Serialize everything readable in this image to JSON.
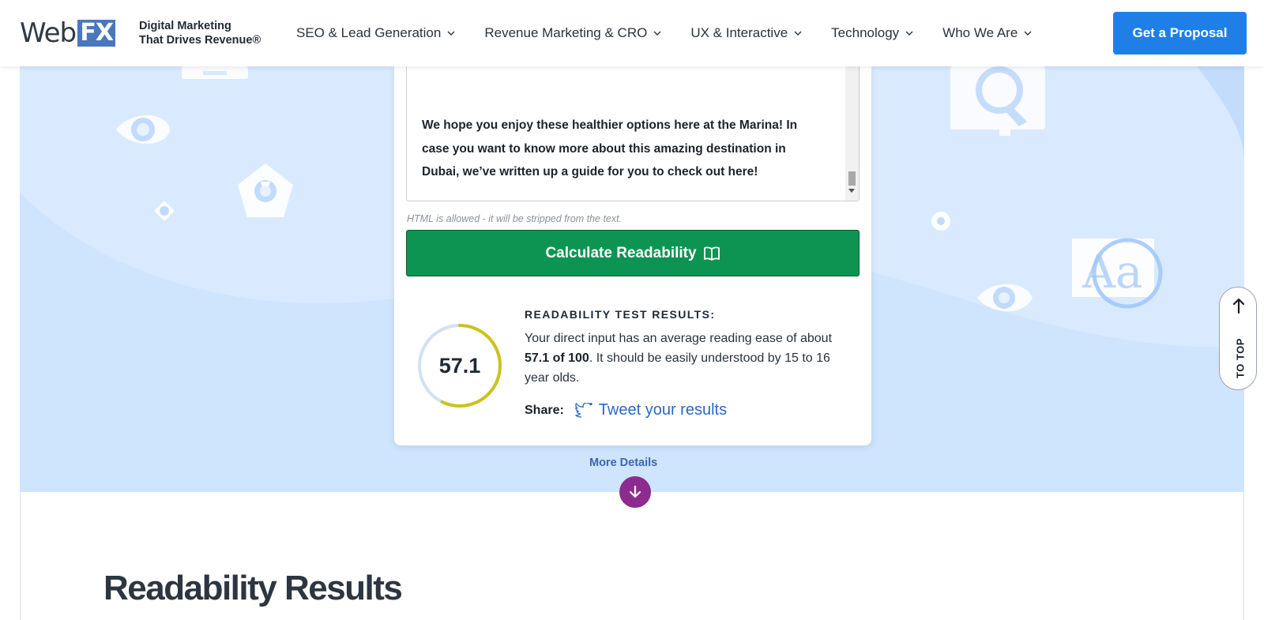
{
  "header": {
    "logo": {
      "web": "Web",
      "fx": "FX"
    },
    "tagline_line1": "Digital Marketing",
    "tagline_line2": "That Drives Revenue®",
    "nav": [
      {
        "label": "SEO & Lead Generation"
      },
      {
        "label": "Revenue Marketing & CRO"
      },
      {
        "label": "UX & Interactive"
      },
      {
        "label": "Technology"
      },
      {
        "label": "Who We Are"
      }
    ],
    "cta_label": "Get a Proposal"
  },
  "tool": {
    "textarea_text": "We hope you enjoy these healthier options here at the Marina! In case you want to know more about this amazing destination in Dubai, we’ve written up a guide for you to check out here!",
    "hint": "HTML is allowed - it will be stripped from the text.",
    "calculate_label": "Calculate Readability",
    "score": "57.1",
    "score_fraction": 0.571,
    "results_title": "READABILITY TEST RESULTS:",
    "results_text_1": "Your direct input has an average reading ease of about ",
    "results_score_strong": "57.1 of 100",
    "results_text_2": ". It should be easily understood by 15 to 16 year olds.",
    "share_label": "Share:",
    "tweet_label": "Tweet your results"
  },
  "more_details": "More Details",
  "to_top": "TO TOP",
  "section_title": "Readability Results",
  "colors": {
    "brand_blue": "#1f7fe6",
    "hero_bg": "#cfe4fd",
    "calc_green": "#0e9452",
    "gauge_yellow": "#cdc21b",
    "down_purple": "#8d2b8e"
  }
}
